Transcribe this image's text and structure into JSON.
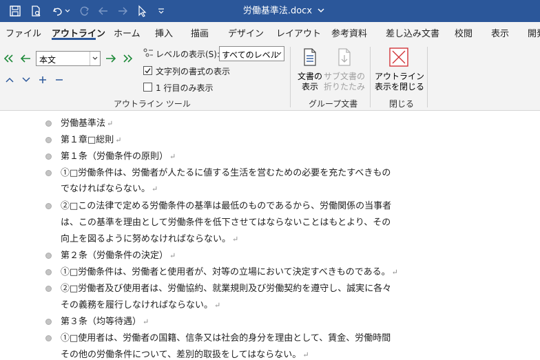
{
  "window": {
    "title": "労働基準法.docx"
  },
  "tabs": [
    "ファイル",
    "アウトライン",
    "ホーム",
    "挿入",
    "描画",
    "デザイン",
    "レイアウト",
    "参考資料",
    "差し込み文書",
    "校閲",
    "表示",
    "開発"
  ],
  "ribbon": {
    "outline_tools": {
      "level_value": "本文",
      "show_level_label": "レベルの表示(S):",
      "show_level_value": "すべてのレベル",
      "show_text_formatting": "文字列の書式の表示",
      "show_text_formatting_checked": true,
      "show_first_line_only": "1 行目のみ表示",
      "show_first_line_only_checked": false,
      "group_label": "アウトライン ツール"
    },
    "master_document": {
      "show_document_line1": "文書の",
      "show_document_line2": "表示",
      "collapse_subdocs_line1": "サブ文書の",
      "collapse_subdocs_line2": "折りたたみ",
      "group_label": "グループ文書"
    },
    "close": {
      "close_label_line1": "アウトライン",
      "close_label_line2": "表示を閉じる",
      "group_label": "閉じる"
    }
  },
  "document": {
    "lines": [
      "労働基準法",
      "第１章□総則",
      "第１条（労働条件の原則）",
      "①□労働条件は、労働者が人たるに値する生活を営むための必要を充たすべきもの",
      "でなければならない。",
      "②□この法律で定める労働条件の基準は最低のものであるから、労働関係の当事者",
      "は、この基準を理由として労働条件を低下させてはならないことはもとより、その",
      "向上を図るように努めなければならない。",
      "第２条（労働条件の決定）",
      "①□労働条件は、労働者と使用者が、対等の立場において決定すべきものである。",
      "②□労働者及び使用者は、労働協約、就業規則及び労働契約を遵守し、誠実に各々",
      "その義務を履行しなければならない。",
      "第３条（均等待遇）",
      "①□使用者は、労働者の国籍、信条又は社会的身分を理由として、賃金、労働時間",
      "その他の労働条件について、差別的取扱をしてはならない。"
    ],
    "paragraph_mark": "↵"
  }
}
